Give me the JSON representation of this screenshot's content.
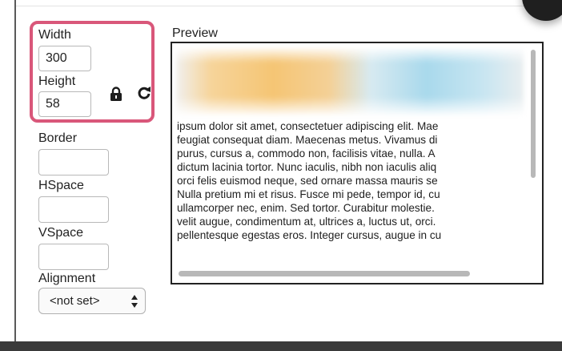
{
  "dimensions": {
    "width_label": "Width",
    "width_value": "300",
    "height_label": "Height",
    "height_value": "58",
    "lock_icon": "lock-icon",
    "reset_icon": "refresh-icon"
  },
  "fields": {
    "border_label": "Border",
    "border_value": "",
    "hspace_label": "HSpace",
    "hspace_value": "",
    "vspace_label": "VSpace",
    "vspace_value": "",
    "alignment_label": "Alignment",
    "alignment_selected": "<not set>"
  },
  "preview": {
    "label": "Preview",
    "lines": [
      "ipsum dolor sit amet, consectetuer adipiscing elit. Mae",
      "feugiat consequat diam. Maecenas metus. Vivamus di",
      "purus, cursus a, commodo non, facilisis vitae, nulla. A",
      "dictum lacinia tortor. Nunc iaculis, nibh non iaculis aliq",
      "orci felis euismod neque, sed ornare massa mauris se",
      "Nulla pretium mi et risus. Fusce mi pede, tempor id, cu",
      "ullamcorper nec, enim. Sed tortor. Curabitur molestie.",
      "velit augue, condimentum at, ultrices a, luctus ut, orci.",
      "pellentesque egestas eros. Integer cursus, augue in cu"
    ]
  },
  "colors": {
    "highlight_border": "#d9577a"
  }
}
